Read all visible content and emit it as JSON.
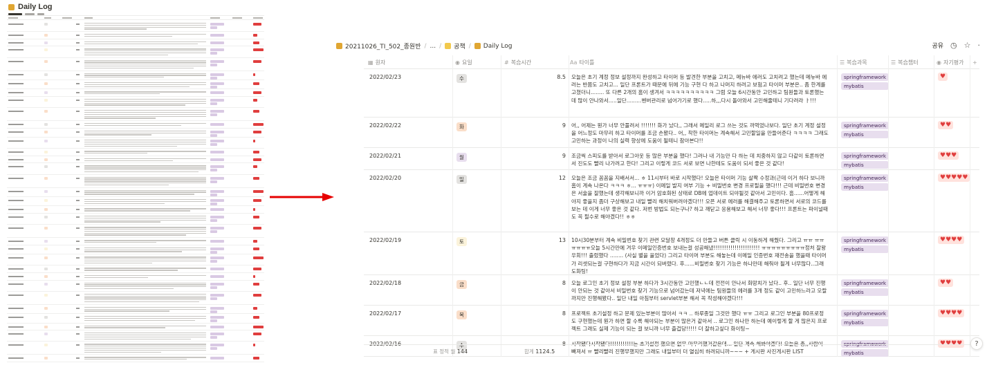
{
  "overview": {
    "title": "Daily Log",
    "icon_color": "#e0a632",
    "rows": 55
  },
  "arrow_color": "#e60000",
  "breadcrumb": {
    "items": [
      "20211026_TI_502_종원반",
      "...",
      "공책",
      "Daily Log"
    ],
    "separator": "/"
  },
  "top_actions": {
    "share": "공유",
    "clock_icon": "clock-icon",
    "star_icon": "star-icon",
    "more": "·"
  },
  "columns": {
    "date": "원자",
    "day": "요일",
    "hours": "복습시간",
    "title": "타이틀",
    "subject": "복습과목",
    "chapter": "복습챕터",
    "eval": "자기평가",
    "add": "+"
  },
  "colors": {
    "tag_bg": "#e8deee",
    "heart": "#e03e3e",
    "heart_badge": "#ffe2dd"
  },
  "rows": [
    {
      "date": "2022/02/23",
      "day": "수",
      "day_bg": "#e3e2e0",
      "hours": "8.5",
      "title": "오늘은 초기 계정 정보 설정까지 완성하고 타이머 등 발견한 부분을 고치고, 메뉴바 에러도 고치려고 했는데 메뉴바 에러는 반쯤도 고치고... 일단 프론트가 때문에 뒤에 기능 구현 다 하고 나머지 하려고 보험고 타이머 부분은.. 좀 한계를 고쳤더니........ 또 다른 2개의 홈이 생겨서 ㅋㅋㅋㅋㅋㅋㅋㅋㅋㅋ 그럼 오늘 6시간동안 고민하고 팀원들과 토론했는데 많이 안나와서.....일단.........벤버관리로 넘어가기로 했다.....하,,,다시 돌아와서 고민해줄테니 기다려라 ㅏ!!!",
      "subjects": [
        "springframework",
        "mybatis"
      ],
      "hearts": 1
    },
    {
      "date": "2022/02/22",
      "day": "화",
      "day_bg": "#fadec9",
      "hours": "9",
      "title": "어,, 어제는 뭔가 너무 안풀려서 !!!!!!! 화가 났다,, 그래서 메일리 로그 쓰는 것도 까먹었나보다. 일단 초기 계정 설정을 어느정도 마무리 하고 타이머를 조금 손봤다.. 어,, 착한 타이머는 계속해서 고민할일을 만들어준다 ㅋㅋㅋㅋ 그래도 고민하는 과정이 나의 실력 향상에 도움이 될테니 참아본다!!",
      "subjects": [
        "springframework",
        "mybatis"
      ],
      "hearts": 2
    },
    {
      "date": "2022/02/21",
      "day": "월",
      "day_bg": "#e8deee",
      "hours": "9",
      "title": "조금씩 스피도를 받아서 로그아웃 등 많은 부분을 했다! 그러나 내 기능만 다 하는 데 치중하지 않고 다같이 토론하면서 진도도 빨리 나가려고 한다! 그리고 이렇게 코드 서로 보면 나한테도 도움이 되서 좋은 것 같다!",
      "subjects": [
        "springframework",
        "mybatis"
      ],
      "hearts": 3
    },
    {
      "date": "2022/02/20",
      "day": "일",
      "day_bg": "#e3e2e0",
      "hours": "12",
      "title": "오늘은 조금 꼼꼼을 지배서서... ㅎ 11시부터 바로 시작했다! 오늘은 타이머 기능 살짝 수정과(근데 이거 하다 보니까 홈이 계속 나온다 ㅋㅋㅋ ㅎ... ㅠㅠㅠ) 이메일 발지 여부 기능 + 비밀번호 변경 프로필을 했다!!! 근데 비밀번호 변경은 서술을 잘했는데 생각해보니까 이거 암호화된 상태로 DB에 업데이트 되야될것 같아서 고민이다. 흠......어떻게 해야지 좋을지 좀더 구상해보고 내일 빨리 해치워버려야겠다!!! 오픈 서로 에러를 해결해주고 토론하면서 서로의 코드를 보는 데 이게 너무 좋은 것 같다. 저번 방법도 되는구나? 하고 깨닫고 응용해보고 해서 너무 좋다!!! 프론트는 파이널때도 꼭 필수로 해야겠다!! ㅎㅎ",
      "subjects": [
        "springframework",
        "mybatis"
      ],
      "hearts": 5
    },
    {
      "date": "2022/02/19",
      "day": "토",
      "day_bg": "#fbf3db",
      "hours": "13",
      "title": "10시30분부터 계속 비밀번호 찾기 관련 모달창 4개정도 더 만들고 버튼 클릭 시 이동하게 해줬다. 그리고 ㅠㅠ ㅠㅠㅠㅠㅠㅠ오늘 5시간만에 겨우 이메일인증번호 보내는걸 성공해냈!!!!!!!!!!!!!!!!!!!!!! ㅠㅠㅠㅠㅠㅠㅠㅠㅠ정처 잘왕우회!!! 출렀했다 ........ (사실 별을 울었다) 그리고 타이머 부분도 해놓는데 이메일 인증번호 재전송을 했을때 타이머가 리셋되는걸 구현하다가 지금 시간이 되버렸다. 후......비밀번호 찾기 기능은 하나만데 해줘야 될게 너무많다..그래도화팅!",
      "subjects": [
        "springframework",
        "mybatis"
      ],
      "hearts": 4
    },
    {
      "date": "2022/02/18",
      "day": "금",
      "day_bg": "#fadec9",
      "hours": "8",
      "title": "오늘 로그인 초기 정보 설정 부분 하다가 3시간동안 고민했ㄴㄴ데 전전이 안나서 화망치가 났다.. 후.. 일단 너무 진행이 안되는 것 같아서 비밀번호 찾기 기능으로 넘어갔는데 저녁에는 팀원들의 에러를 3개 정도 같이 고민하느라고 오랄까지만 진행해봤다.. 일단 내일 아침부터 servlet부분 해서 꼭 작성해야겠다!!!",
      "subjects": [
        "springframework",
        "mybatis"
      ],
      "hearts": 2
    },
    {
      "date": "2022/02/17",
      "day": "목",
      "day_bg": "#fadec9",
      "hours": "8",
      "title": "프로젝트 초기설정 하고 문제 있는부분이 많아서 ㅋㅋ .. 하루종일 그것만 했다 ㅠㅠ 그리고 로그인 부분을 80프로정도 구현했는데 뭔가 하면 할 수록 해야되는 부분이 많은거 같아서 .. 로그인 하나만 하는데 예이렇게 할 게 많은지 프로젝트 그래도 실제 기능이 되는 걸 보니까 너무 즐겁당!!!!! 더 잘하고싶다 화이팅~",
      "subjects": [
        "springframework",
        "mybatis"
      ],
      "hearts": 4
    },
    {
      "date": "2022/02/16",
      "day": "수",
      "day_bg": "#e3e2e0",
      "hours": "8",
      "title": "시작됐다시작됐다!!!!!!!!!!!는 초기설정 했으면 없무 마무리했거같은데... 일단 계속 해봐야겠다! 오늘은 종,,사람이 빠져서 ㅠ 빨리빨리 진행무했지만 그래도 내일부터 더 열심히 하려되니까~~~ + 게시판 사진게시판 LIST",
      "subjects": [
        "springframework",
        "mybatis"
      ],
      "hearts": 4
    }
  ],
  "footer": {
    "unique_label": "표 정적 월",
    "unique_value": "144",
    "sum_label": "합계",
    "sum_value": "1124.5"
  },
  "help_label": "?"
}
